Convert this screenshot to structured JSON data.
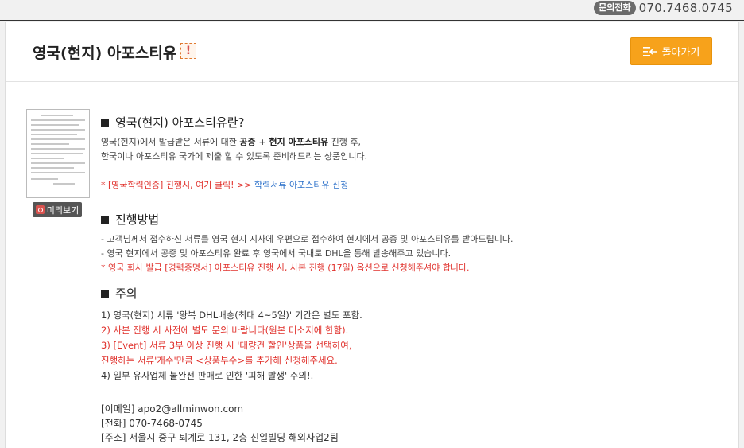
{
  "topbar": {
    "phone_badge": "문의전화",
    "phone_number": "070.7468.0745"
  },
  "header": {
    "title": "영국(현지) 아포스티유",
    "notice_glyph": "!",
    "back_label": "돌아가기"
  },
  "preview": {
    "label": "미리보기"
  },
  "section1": {
    "title": "영국(현지) 아포스티유란?",
    "line1_a": "영국(현지)에서 발급받은 서류에 대한 ",
    "line1_b": "공증 + 현지 아포스티유",
    "line1_c": " 진행 후,",
    "line2": "한국이나 아포스티유 국가에 제출 할 수 있도록 준비해드리는 상품입니다.",
    "promo_red": "* [영국학력인증] 진행시, 여기 클릭! >>",
    "promo_link": " 학력서류 아포스티유 신청"
  },
  "section2": {
    "title": "진행방법",
    "line1": "- 고객님께서 접수하신 서류를 영국 현지 지사에 우편으로 접수하여 현지에서 공증 및 아포스티유를 받아드립니다.",
    "line2": "- 영국 현지에서 공증 및 아포스티유 완료 후 영국에서 국내로 DHL을 통해 발송해주고 있습니다.",
    "line3": "* 영국 회사 발급 [경력증명서] 아포스티유 진행 시, 사본 진행 (17일) 옵션으로 신청해주셔야 합니다."
  },
  "section3": {
    "title": "주의",
    "item1": "1) 영국(현지) 서류 '왕복 DHL배송(최대 4~5일)' 기간은 별도 포함.",
    "item2": "2) 사본 진행 시 사전에 별도 문의 바랍니다(원본 미소지에 한함).",
    "item3a": "3) [Event] 서류 3부 이상 진행 시 '대량건 할인'상품을 선택하여,",
    "item3b": "진행하는 서류'개수'만큼 <상품부수>를 추가해 신청해주세요.",
    "item4": "4) 일부 유사업체 불완전 판매로 인한 '피해 발생' 주의!."
  },
  "contact": {
    "email": "[이메일] apo2@allminwon.com",
    "phone": "[전화] 070-7468-0745",
    "address": "[주소] 서울시 중구 퇴계로 131, 2층 신일빌딩 해외사업2팀"
  },
  "colors": {
    "accent": "#f7a21b",
    "red": "#e0302b",
    "link": "#2a6fc9"
  }
}
